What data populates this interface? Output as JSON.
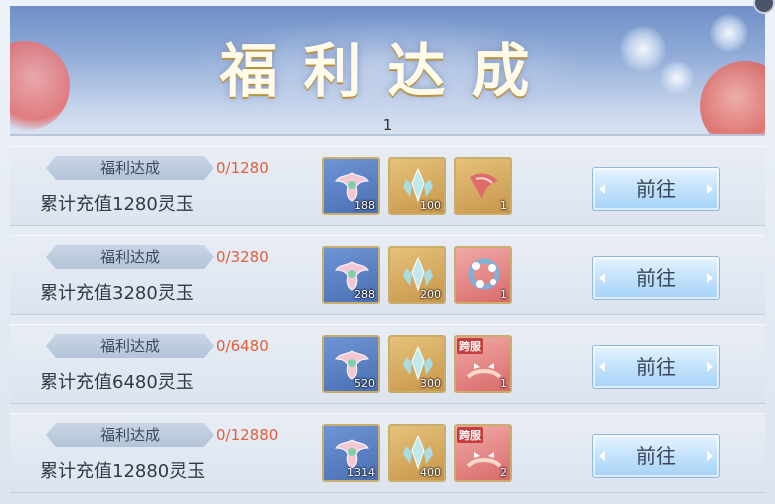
{
  "banner": {
    "title": "福利达成",
    "page_number": "1"
  },
  "colors": {
    "progress": "#e0603a",
    "button_bg": "#bfe0fb",
    "item_border": "#c9ad6a"
  },
  "rows": [
    {
      "tag": "福利达成",
      "progress": "0/1280",
      "description": "累计充值1280灵玉",
      "button": "前往",
      "items": [
        {
          "icon": "winged-charm-icon",
          "count": "188",
          "bg": "blue"
        },
        {
          "icon": "crystal-icon",
          "count": "100",
          "bg": "gold"
        },
        {
          "icon": "fan-ribbon-icon",
          "count": "1",
          "bg": "gold"
        }
      ]
    },
    {
      "tag": "福利达成",
      "progress": "0/3280",
      "description": "累计充值3280灵玉",
      "button": "前往",
      "items": [
        {
          "icon": "winged-charm-icon",
          "count": "288",
          "bg": "blue"
        },
        {
          "icon": "crystal-icon",
          "count": "200",
          "bg": "gold"
        },
        {
          "icon": "flower-wreath-icon",
          "count": "1",
          "bg": "red"
        }
      ]
    },
    {
      "tag": "福利达成",
      "progress": "0/6480",
      "description": "累计充值6480灵玉",
      "button": "前往",
      "items": [
        {
          "icon": "winged-charm-icon",
          "count": "520",
          "bg": "blue"
        },
        {
          "icon": "crystal-icon",
          "count": "300",
          "bg": "gold"
        },
        {
          "icon": "bird-headdress-icon",
          "count": "1",
          "bg": "red",
          "badge": "跨服"
        }
      ]
    },
    {
      "tag": "福利达成",
      "progress": "0/12880",
      "description": "累计充值12880灵玉",
      "button": "前往",
      "items": [
        {
          "icon": "winged-charm-icon",
          "count": "1314",
          "bg": "blue"
        },
        {
          "icon": "crystal-icon",
          "count": "400",
          "bg": "gold"
        },
        {
          "icon": "bird-headdress-icon",
          "count": "2",
          "bg": "red",
          "badge": "跨服"
        }
      ]
    }
  ]
}
